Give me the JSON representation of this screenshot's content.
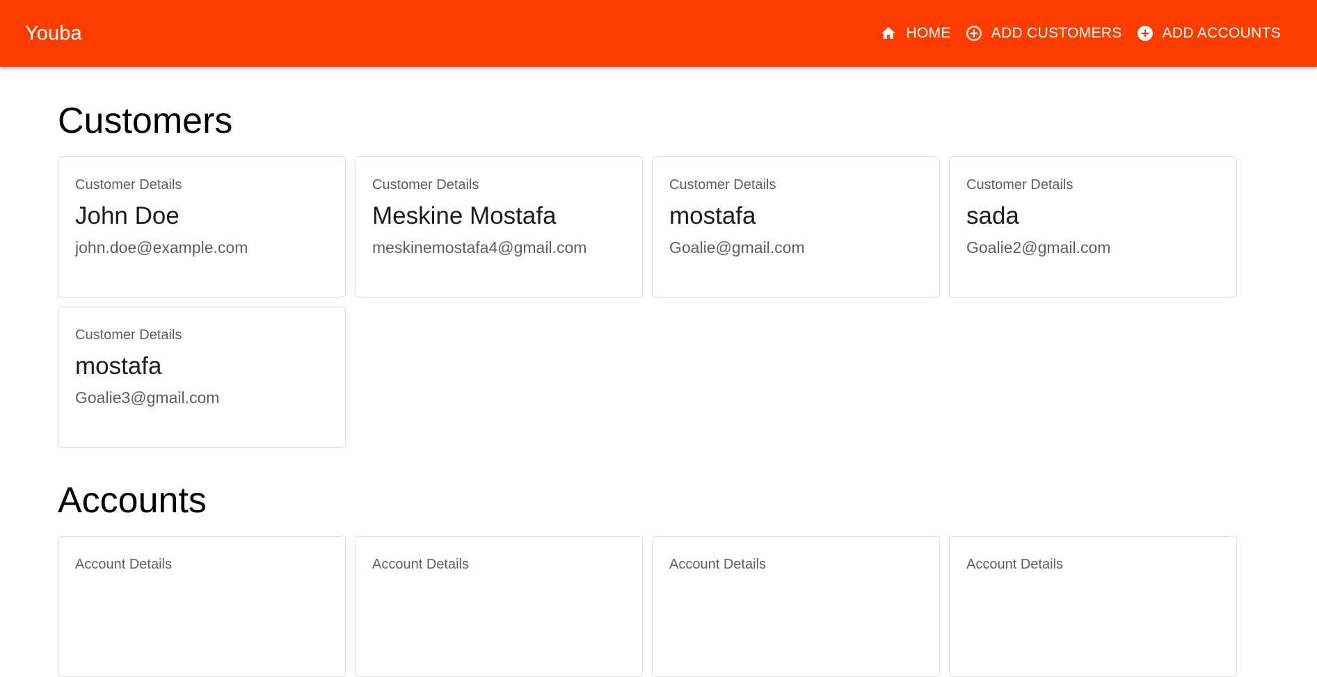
{
  "header": {
    "brand": "Youba",
    "nav": [
      {
        "label": "HOME",
        "icon": "home-icon"
      },
      {
        "label": "ADD CUSTOMERS",
        "icon": "add-circle-outline-icon"
      },
      {
        "label": "ADD ACCOUNTS",
        "icon": "add-circle-filled-icon"
      }
    ]
  },
  "customers": {
    "title": "Customers",
    "cards": [
      {
        "label": "Customer Details",
        "name": "John Doe",
        "email": "john.doe@example.com"
      },
      {
        "label": "Customer Details",
        "name": "Meskine Mostafa",
        "email": "meskinemostafa4@gmail.com"
      },
      {
        "label": "Customer Details",
        "name": "mostafa",
        "email": "Goalie@gmail.com"
      },
      {
        "label": "Customer Details",
        "name": "sada",
        "email": "Goalie2@gmail.com"
      },
      {
        "label": "Customer Details",
        "name": "mostafa",
        "email": "Goalie3@gmail.com"
      }
    ]
  },
  "accounts": {
    "title": "Accounts",
    "cards": [
      {
        "label": "Account Details"
      },
      {
        "label": "Account Details"
      },
      {
        "label": "Account Details"
      },
      {
        "label": "Account Details"
      }
    ]
  },
  "colors": {
    "appbar": "#ff3d00",
    "text_primary": "#1c1c1c",
    "text_secondary": "#5f5f5f",
    "card_border": "#dcdcdc"
  }
}
